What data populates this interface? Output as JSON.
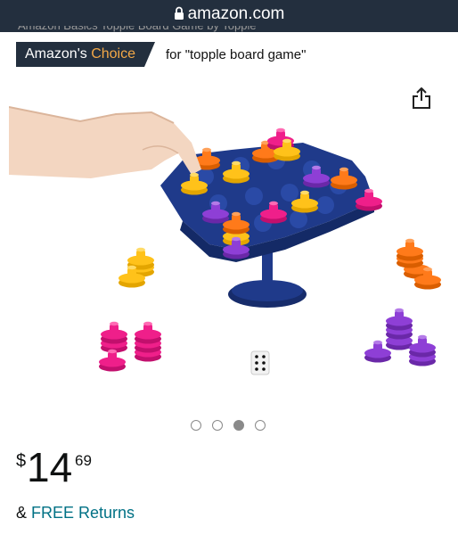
{
  "browser": {
    "url": "amazon.com",
    "truncated_line": "Amazon Basics Topple Board Game by Topple"
  },
  "badge": {
    "prefix": "Amazon's",
    "accent": "Choice",
    "for_text": "for \"topple board game\""
  },
  "gallery": {
    "image_count": 4,
    "active_index": 2
  },
  "price": {
    "symbol": "$",
    "whole": "14",
    "fraction": "69"
  },
  "returns": {
    "prefix": "& ",
    "link": "FREE Returns"
  },
  "colors": {
    "header": "#232f3e",
    "choice_accent": "#f3a847",
    "link": "#007185",
    "board": "#1f3a8a",
    "piece_yellow": "#ffc21a",
    "piece_orange": "#ff7a1a",
    "piece_pink": "#ef1f8a",
    "piece_purple": "#8e3fd6"
  },
  "icons": {
    "lock": "lock-icon",
    "share": "share-icon"
  }
}
